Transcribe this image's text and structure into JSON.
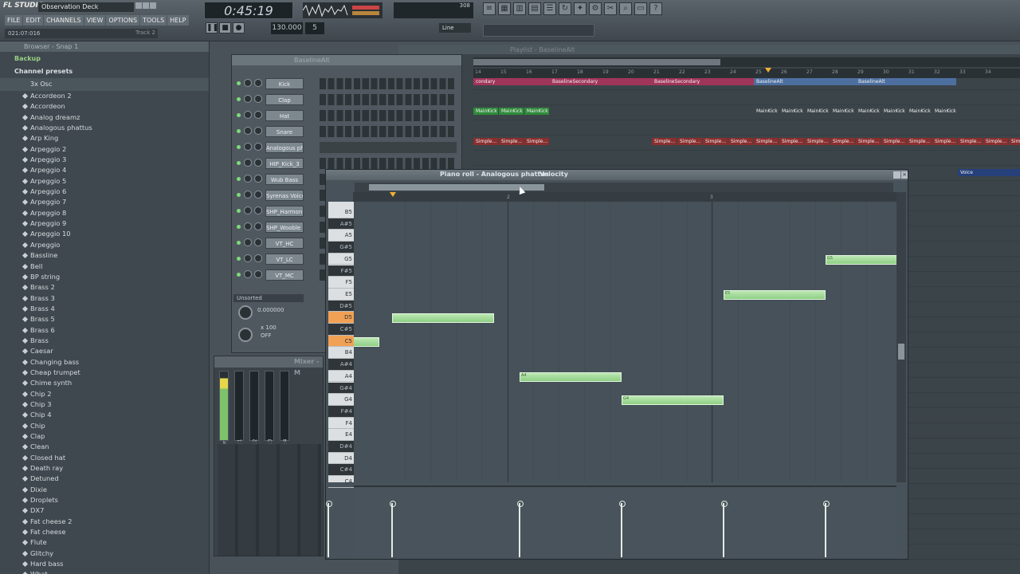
{
  "app": {
    "logo": "FL STUDIO",
    "song_title": "Observation Deck"
  },
  "menu": [
    "FILE",
    "EDIT",
    "CHANNELS",
    "VIEW",
    "OPTIONS",
    "TOOLS",
    "HELP"
  ],
  "status": {
    "time": "021:07:016",
    "hint": "Track 2"
  },
  "transport": {
    "clock": "0:45:19",
    "bpm": "130.000",
    "pattern": "5",
    "snap": "Line"
  },
  "cpu": {
    "value": "308"
  },
  "browser": {
    "title": "Browser - Snap 1",
    "folders": [
      "Backup",
      "Channel presets",
      "3x Osc"
    ],
    "items": [
      "Accordeon 2",
      "Accordeon",
      "Analog dreamz",
      "Analogous phattus",
      "Arp King",
      "Arpeggio 2",
      "Arpeggio 3",
      "Arpeggio 4",
      "Arpeggio 5",
      "Arpeggio 6",
      "Arpeggio 7",
      "Arpeggio 8",
      "Arpeggio 9",
      "Arpeggio 10",
      "Arpeggio",
      "Bassline",
      "Bell",
      "BP string",
      "Brass 2",
      "Brass 3",
      "Brass 4",
      "Brass 5",
      "Brass 6",
      "Brass",
      "Caesar",
      "Changing bass",
      "Cheap trumpet",
      "Chime synth",
      "Chip 2",
      "Chip 3",
      "Chip 4",
      "Chip",
      "Clap",
      "Clean",
      "Closed hat",
      "Death ray",
      "Detuned",
      "Dixie",
      "Droplets",
      "DX7",
      "Fat cheese 2",
      "Fat cheese",
      "Flute",
      "Glitchy",
      "Hard bass",
      "What"
    ]
  },
  "rack": {
    "title": "BaselineAlt",
    "channels": [
      "Kick",
      "Clap",
      "Hat",
      "Snare",
      "Analogous ph...",
      "HIP_Kick_3",
      "Wub Bass",
      "Syrenas Voice",
      "SHP_Harmonic",
      "SHP_Wooble ...",
      "VT_HC",
      "VT_LC",
      "VT_MC"
    ],
    "filter": "Unsorted",
    "readout1": "0.000000",
    "readout2": "x 100",
    "readout3": "OFF"
  },
  "playlist": {
    "title": "Playlist - BaselineAlt",
    "ruler": [
      "14",
      "15",
      "16",
      "17",
      "18",
      "19",
      "20",
      "21",
      "22",
      "23",
      "24",
      "25",
      "26",
      "27",
      "28",
      "29",
      "30",
      "31",
      "32",
      "33",
      "34"
    ],
    "clips_row1": [
      "condary",
      "BaselineSecondary",
      "BaselineSecondary",
      "BaselineAlt",
      "BaselineAlt"
    ],
    "kick_clip": "MainKick",
    "simple_clip": "Simple...",
    "voice_clip": "Voice"
  },
  "mixer": {
    "title": "Mixer - M",
    "strips": [
      "Master",
      "Insert 1",
      "Insert 2",
      "Insert 3",
      "Insert 4"
    ]
  },
  "pianoroll": {
    "title": "Piano roll - Analogous phattus",
    "target": "Velocity",
    "ruler": [
      "2",
      "3"
    ],
    "keys": [
      "B5",
      "A#5",
      "A5",
      "G#5",
      "G5",
      "F#5",
      "F5",
      "E5",
      "D#5",
      "D5",
      "C#5",
      "C5",
      "B4",
      "A#4",
      "A4",
      "G#4",
      "G4",
      "F#4",
      "F4",
      "E4",
      "D#4",
      "D4",
      "C#4",
      "C4"
    ],
    "notes": [
      {
        "pitch": "C5",
        "label": ""
      },
      {
        "pitch": "D5",
        "label": ""
      },
      {
        "pitch": "A4",
        "label": "A4"
      },
      {
        "pitch": "G4",
        "label": "G4"
      },
      {
        "pitch": "E5",
        "label": "E5"
      },
      {
        "pitch": "G5",
        "label": "G5"
      }
    ]
  }
}
